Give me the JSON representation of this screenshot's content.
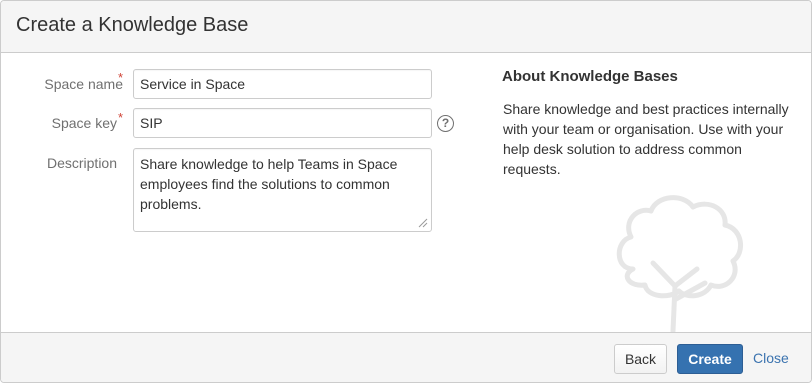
{
  "dialog": {
    "title": "Create a Knowledge Base"
  },
  "form": {
    "space_name": {
      "label": "Space name",
      "required_marker": "*",
      "value": "Service in Space"
    },
    "space_key": {
      "label": "Space key",
      "required_marker": "*",
      "value": "SIP"
    },
    "description": {
      "label": "Description",
      "value": "Share knowledge to help Teams in Space employees find the solutions to common problems."
    },
    "help_icon": "?"
  },
  "about": {
    "title": "About Knowledge Bases",
    "text": "Share knowledge and best practices internally with your team or organisation. Use with your help desk solution to address common requests.",
    "illustration_icon": "tree-icon"
  },
  "footer": {
    "back_label": "Back",
    "create_label": "Create",
    "close_label": "Close"
  },
  "colors": {
    "primary_button": "#3572b0",
    "link": "#3b73af",
    "required": "#d04437",
    "header_bg": "#f5f5f5"
  }
}
